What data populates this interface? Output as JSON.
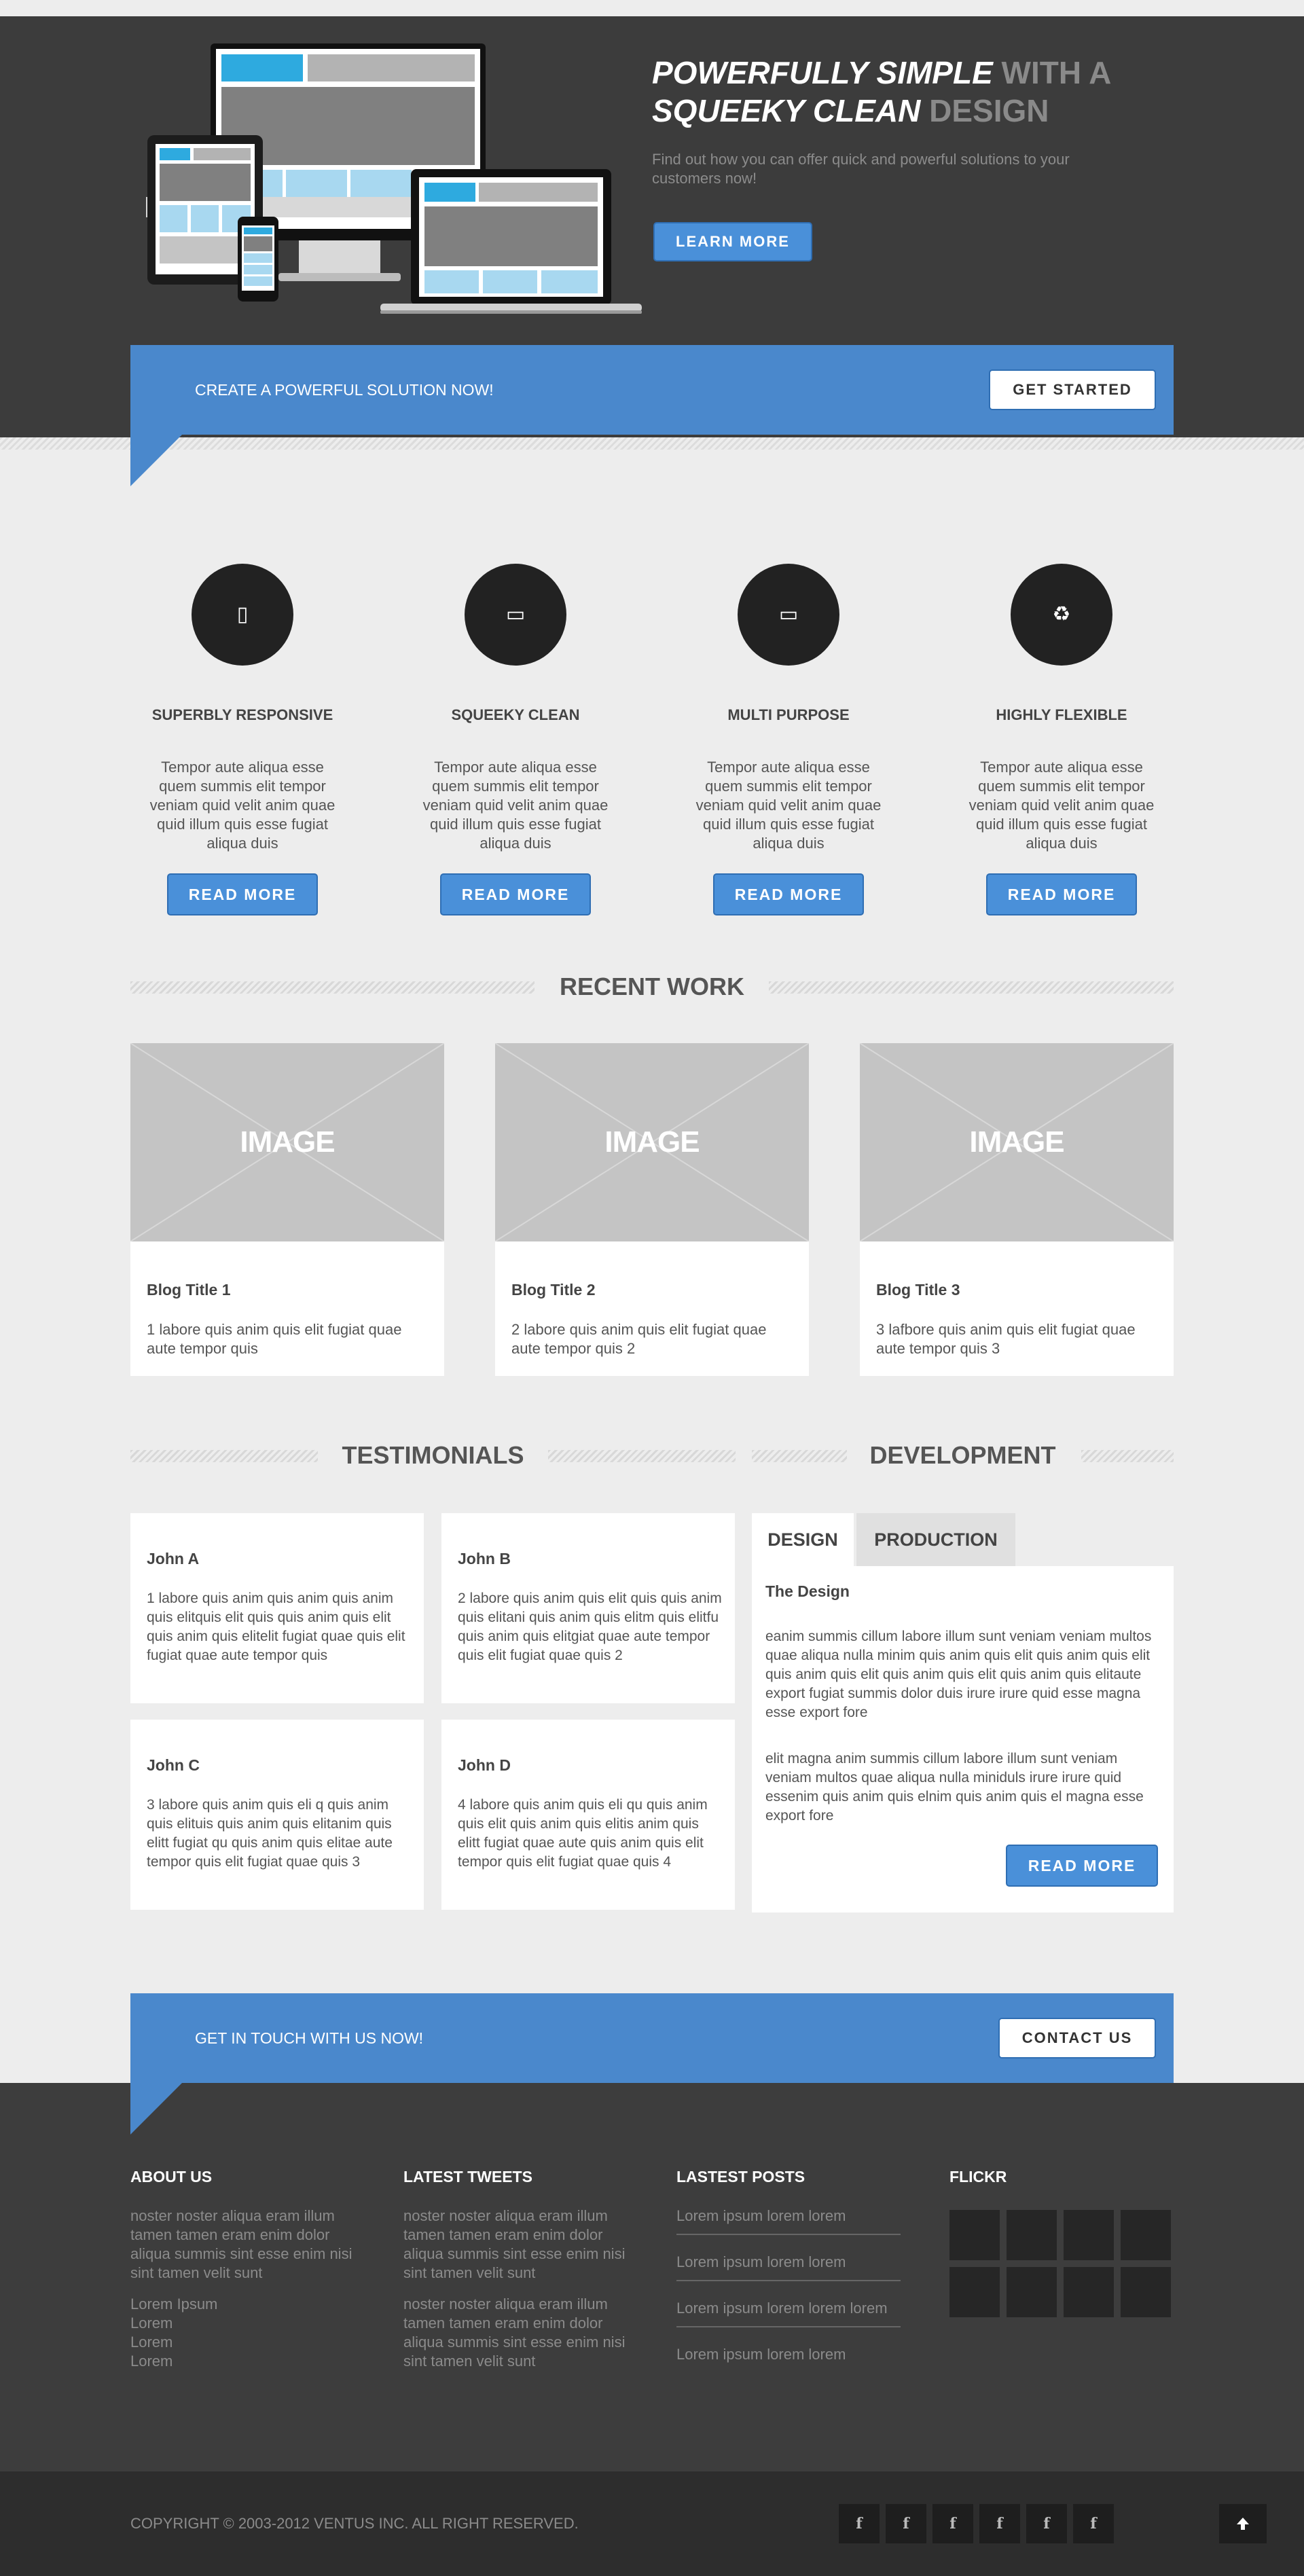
{
  "hero": {
    "title_line1_highlight": "POWERFULLY SIMPLE",
    "title_line1_rest": " WITH A",
    "title_line2_highlight": "SQUEEKY CLEAN",
    "title_line2_rest": " DESIGN",
    "subtitle": "Find out how you can offer quick and powerful solutions to your customers now!",
    "button": "LEARN MORE"
  },
  "banner_top": {
    "text": "CREATE A POWERFUL SOLUTION NOW!",
    "button": "GET STARTED"
  },
  "features": [
    {
      "icon": "mobile-icon",
      "glyph": "▯",
      "title": "SUPERBLY RESPONSIVE",
      "text": "Tempor aute aliqua esse quem summis elit tempor veniam quid velit anim quae quid illum quis esse fugiat aliqua duis",
      "button": "READ MORE"
    },
    {
      "icon": "desktop-icon",
      "glyph": "▭",
      "title": "SQUEEKY CLEAN",
      "text": "Tempor aute aliqua esse quem summis elit tempor veniam quid velit anim quae quid illum quis esse fugiat aliqua duis",
      "button": "READ MORE"
    },
    {
      "icon": "laptop-icon",
      "glyph": "▭",
      "title": "MULTI PURPOSE",
      "text": "Tempor aute aliqua esse quem summis elit tempor veniam quid velit anim quae quid illum quis esse fugiat aliqua duis",
      "button": "READ MORE"
    },
    {
      "icon": "recycle-icon",
      "glyph": "♻",
      "title": "HIGHLY FLEXIBLE",
      "text": "Tempor aute aliqua esse quem summis elit tempor veniam quid velit anim quae quid illum quis esse fugiat aliqua duis",
      "button": "READ MORE"
    }
  ],
  "recent_work": {
    "heading": "RECENT WORK",
    "image_label": "IMAGE",
    "items": [
      {
        "title": "Blog Title 1",
        "text": "1 labore quis anim quis elit fugiat quae aute tempor quis"
      },
      {
        "title": "Blog Title 2",
        "text": "2 labore quis anim quis elit fugiat quae aute tempor quis 2"
      },
      {
        "title": "Blog Title 3",
        "text": "3 lafbore quis anim quis elit fugiat quae aute tempor quis 3"
      }
    ]
  },
  "testimonials": {
    "heading": "TESTIMONIALS",
    "items": [
      {
        "name": "John A",
        "text": "1 labore quis anim quis anim quis anim quis elitquis elit quis quis anim quis elit quis anim quis elitelit fugiat quae quis elit fugiat quae aute tempor quis"
      },
      {
        "name": "John B",
        "text": "2 labore quis anim quis elit quis quis anim quis elitani quis anim quis elitm quis elitfu quis anim quis elitgiat quae aute tempor quis elit fugiat quae quis 2"
      },
      {
        "name": "John C",
        "text": "3 labore quis anim quis eli q quis anim quis elituis quis anim quis elitanim quis elitt fugiat qu quis anim quis elitae aute tempor quis elit fugiat quae quis 3"
      },
      {
        "name": "John D",
        "text": "4 labore quis anim quis eli qu quis anim quis elit quis anim quis elitis anim quis elitt fugiat quae aute quis anim quis elit tempor quis elit fugiat quae quis 4"
      }
    ]
  },
  "development": {
    "heading": "DEVELOPMENT",
    "tabs": [
      "DESIGN",
      "PRODUCTION"
    ],
    "panel_title": "The Design",
    "paragraph1": "eanim summis cillum labore illum sunt veniam veniam multos quae aliqua nulla minim quis anim quis elit quis anim quis elit quis anim quis elit quis anim quis elit quis anim quis elitaute export fugiat summis dolor duis irure irure quid esse magna esse export fore",
    "paragraph2": "elit magna anim summis cillum labore illum sunt veniam veniam multos quae aliqua nulla miniduls irure irure quid essenim quis anim quis elnim quis anim quis el magna esse export fore",
    "button": "READ MORE"
  },
  "banner_bottom": {
    "text": "GET IN TOUCH WITH US NOW!",
    "button": "CONTACT US"
  },
  "footer": {
    "about": {
      "heading": "ABOUT US",
      "text": "noster noster aliqua eram illum tamen tamen eram enim dolor aliqua summis sint esse enim nisi sint tamen velit sunt",
      "links": [
        "Lorem Ipsum",
        "Lorem",
        "Lorem",
        "Lorem"
      ]
    },
    "tweets": {
      "heading": "LATEST TWEETS",
      "items": [
        "noster noster aliqua eram illum tamen tamen eram enim dolor aliqua summis sint esse enim nisi sint tamen velit sunt",
        "noster noster aliqua eram illum tamen tamen eram enim dolor aliqua summis sint esse enim nisi sint tamen velit sunt"
      ]
    },
    "posts": {
      "heading": "LASTEST POSTS",
      "items": [
        "Lorem ipsum lorem lorem",
        "Lorem ipsum lorem lorem",
        "Lorem ipsum lorem lorem lorem",
        "Lorem ipsum lorem lorem"
      ]
    },
    "flickr": {
      "heading": "FLICKR"
    }
  },
  "bottom_bar": {
    "copyright": "COPYRIGHT © 2003-2012 VENTUS INC. ALL RIGHT RESERVED.",
    "social_icon": "facebook-icon",
    "social_glyph": "f",
    "to_top_glyph": "🡅"
  },
  "colors": {
    "accent": "#4a88cc",
    "dark": "#3c3c3c",
    "footer_dark": "#2d2d2d"
  }
}
